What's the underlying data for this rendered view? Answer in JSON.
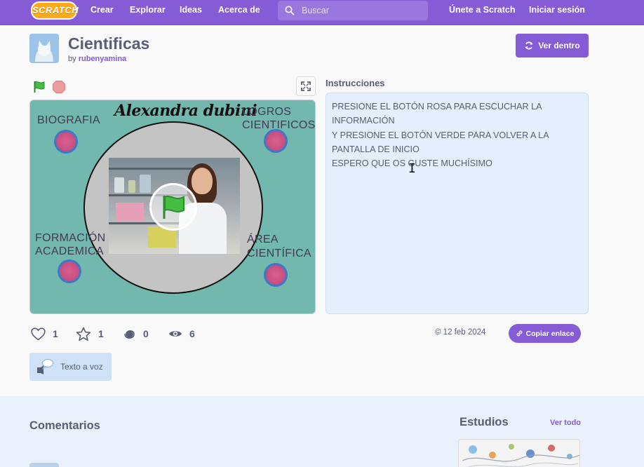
{
  "nav": {
    "logo": "SCRATCH",
    "links": [
      "Crear",
      "Explorar",
      "Ideas",
      "Acerca de"
    ],
    "search_placeholder": "Buscar",
    "join": "Únete a Scratch",
    "signin": "Iniciar sesión"
  },
  "project": {
    "title": "Cientificas",
    "by": "by",
    "author": "rubenyamina",
    "see_inside": "Ver dentro"
  },
  "stage": {
    "headline": "Alexandra dubini",
    "labels": {
      "bio": "BIOGRAFIA",
      "logros1": "LOGROS",
      "logros2": "CIENTIFICOS",
      "form1": "FORMACIÓN",
      "form2": "ACADEMICA",
      "area1": "ÁREA",
      "area2": "CIENTÍFICA"
    }
  },
  "instructions": {
    "title": "Instrucciones",
    "lines": [
      "PRESIONE EL BOTÓN ROSA PARA ESCUCHAR LA",
      "INFORMACIÓN",
      "Y PRESIONE EL BOTÓN VERDE PARA VOLVER A LA",
      "PANTALLA DE INICIO",
      "ESPERO QUE OS GUSTE MUCHÍSIMO"
    ]
  },
  "stats": {
    "loves": "1",
    "favorites": "1",
    "remixes": "0",
    "views": "6",
    "date": "© 12 feb 2024",
    "copy_link": "Copiar enlace"
  },
  "tts": {
    "label": "Texto a voz"
  },
  "bottom": {
    "comments": "Comentarios",
    "studios": "Estudios",
    "see_all": "Ver todo"
  },
  "colors": {
    "brand": "#855cd6",
    "stage_bg": "#72b8ae",
    "instructions_bg": "#e5eefc",
    "pink_button": "#d8608e",
    "logo": "#ffab19"
  },
  "icons": [
    "search-icon",
    "green-flag-icon",
    "stop-icon",
    "fullscreen-icon",
    "remix-icon",
    "heart-icon",
    "star-icon",
    "spiral-icon",
    "eye-icon",
    "link-icon",
    "speech-icon"
  ]
}
